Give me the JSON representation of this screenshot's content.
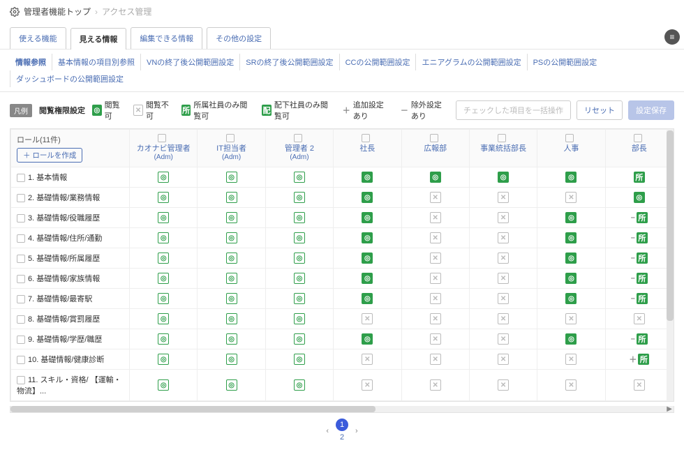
{
  "breadcrumb": {
    "level1": "管理者機能トップ",
    "level2": "アクセス管理"
  },
  "tabs": [
    "使える機能",
    "見える情報",
    "編集できる情報",
    "その他の設定"
  ],
  "active_tab": 1,
  "subtabs": [
    "情報参照",
    "基本情報の項目別参照",
    "VNの終了後公開範囲設定",
    "SRの終了後公開範囲設定",
    "CCの公開範囲設定",
    "エニアグラムの公開範囲設定",
    "PSの公開範囲設定",
    "ダッシュボードの公開範囲設定"
  ],
  "active_subtab": 0,
  "legend": {
    "badge": "凡例",
    "title": "閲覧権限設定",
    "items": [
      {
        "icon": "allow-filled",
        "label": "閲覧可"
      },
      {
        "icon": "deny",
        "label": "閲覧不可"
      },
      {
        "icon": "dept",
        "glyph": "所",
        "label": "所属社員のみ閲覧可"
      },
      {
        "icon": "sub",
        "glyph": "配",
        "label": "配下社員のみ閲覧可"
      },
      {
        "icon": "plus",
        "glyph": "＋",
        "label": "追加設定あり"
      },
      {
        "icon": "minus",
        "glyph": "－",
        "label": "除外設定あり"
      }
    ]
  },
  "actions": {
    "bulk": "チェックした項目を一括操作",
    "reset": "リセット",
    "save": "設定保存"
  },
  "role_header": {
    "title": "ロール(11件)",
    "create": "＋ ロールを作成"
  },
  "columns": [
    {
      "name": "カオナビ管理者",
      "sub": "(Adm)"
    },
    {
      "name": "IT担当者",
      "sub": "(Adm)"
    },
    {
      "name": "管理者 2",
      "sub": "(Adm)"
    },
    {
      "name": "社長",
      "sub": ""
    },
    {
      "name": "広報部",
      "sub": ""
    },
    {
      "name": "事業統括部長",
      "sub": ""
    },
    {
      "name": "人事",
      "sub": ""
    },
    {
      "name": "部長",
      "sub": ""
    }
  ],
  "rows": [
    {
      "label": "1. 基本情報",
      "cells": [
        "ao",
        "ao",
        "ao",
        "af",
        "af",
        "af",
        "af",
        "dept"
      ]
    },
    {
      "label": "2. 基礎情報/業務情報",
      "cells": [
        "ao",
        "ao",
        "ao",
        "af",
        "x",
        "x",
        "x",
        "af"
      ]
    },
    {
      "label": "3. 基礎情報/役職履歴",
      "cells": [
        "ao",
        "ao",
        "ao",
        "af",
        "x",
        "x",
        "af",
        "-dept"
      ]
    },
    {
      "label": "4. 基礎情報/住所/通勤",
      "cells": [
        "ao",
        "ao",
        "ao",
        "af",
        "x",
        "x",
        "af",
        "-dept"
      ]
    },
    {
      "label": "5. 基礎情報/所属履歴",
      "cells": [
        "ao",
        "ao",
        "ao",
        "af",
        "x",
        "x",
        "af",
        "-dept"
      ]
    },
    {
      "label": "6. 基礎情報/家族情報",
      "cells": [
        "ao",
        "ao",
        "ao",
        "af",
        "x",
        "x",
        "af",
        "-dept"
      ]
    },
    {
      "label": "7. 基礎情報/最寄駅",
      "cells": [
        "ao",
        "ao",
        "ao",
        "af",
        "x",
        "x",
        "af",
        "-dept"
      ]
    },
    {
      "label": "8. 基礎情報/賞罰履歴",
      "cells": [
        "ao",
        "ao",
        "ao",
        "x",
        "x",
        "x",
        "x",
        "x"
      ]
    },
    {
      "label": "9. 基礎情報/学歴/職歴",
      "cells": [
        "ao",
        "ao",
        "ao",
        "af",
        "x",
        "x",
        "af",
        "-dept"
      ]
    },
    {
      "label": "10. 基礎情報/健康診断",
      "cells": [
        "ao",
        "ao",
        "ao",
        "x",
        "x",
        "x",
        "x",
        "+dept"
      ]
    },
    {
      "label": "11. スキル・資格/ 【運輸・物流】...",
      "cells": [
        "ao",
        "ao",
        "ao",
        "x",
        "x",
        "x",
        "x",
        "x"
      ]
    }
  ],
  "pager": {
    "pages": [
      "1",
      "2"
    ],
    "active": 0
  }
}
